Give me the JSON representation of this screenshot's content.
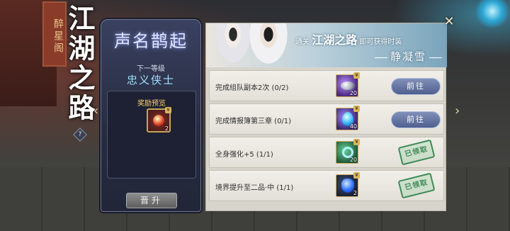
{
  "background": {
    "sign_text": "醉星阁",
    "title_calligraphy": "江湖之路",
    "help_icon": "question-icon"
  },
  "rank_panel": {
    "title": "声名鹊起",
    "next_label": "下一等级",
    "next_name": "忠义侠士",
    "reward_title": "奖励预览",
    "reward_item": {
      "count": "2",
      "icon": "red-gem-icon"
    },
    "promote_label": "晋升"
  },
  "banner": {
    "text_prefix": "通关",
    "text_highlight": "江湖之路",
    "text_suffix": "即可获得时装",
    "outfit_name": "静凝雪"
  },
  "tasks": [
    {
      "text": "完成组队副本2次 (0/2)",
      "reward_count": "20",
      "reward_icon": "silver-ingot-icon",
      "action": "前往",
      "claimed": false
    },
    {
      "text": "完成情报簿第三章 (0/1)",
      "reward_count": "40",
      "reward_icon": "blue-crystal-icon",
      "action": "前往",
      "claimed": false
    },
    {
      "text": "全身强化+5 (1/1)",
      "reward_count": "20",
      "reward_icon": "green-ring-icon",
      "action": "已领取",
      "claimed": true
    },
    {
      "text": "境界提升至二品·中 (1/1)",
      "reward_count": "2",
      "reward_icon": "blue-stone-icon",
      "action": "已领取",
      "claimed": true
    }
  ],
  "colors": {
    "go_button": "#5f6f9e",
    "claimed_stamp": "#3f8a58",
    "reward_title": "#ffd36b"
  }
}
